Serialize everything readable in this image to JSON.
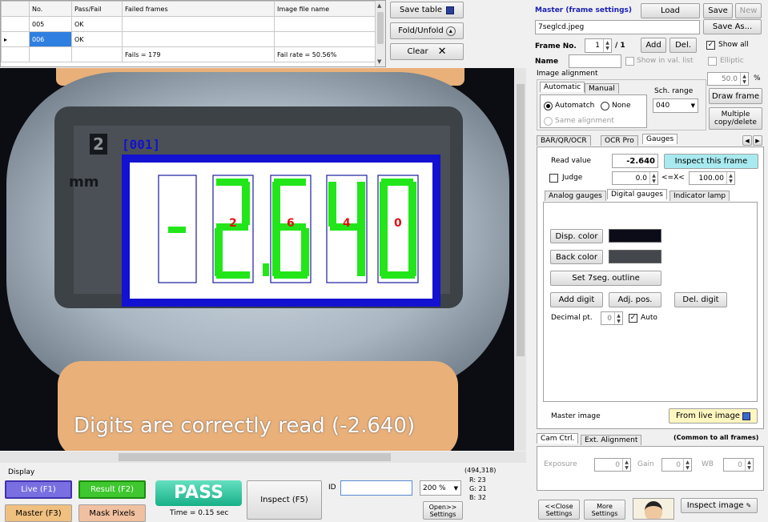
{
  "results_table": {
    "columns": [
      "No.",
      "Pass/Fail",
      "Failed frames",
      "Image file name"
    ],
    "rows": [
      {
        "no": "005",
        "pass_fail": "OK",
        "failed_frames": "",
        "image_file": ""
      },
      {
        "no": "006",
        "pass_fail": "OK",
        "failed_frames": "",
        "image_file": ""
      }
    ],
    "summary": {
      "fails": "Fails = 179",
      "fail_rate": "Fail rate = 50.56%"
    },
    "row_marker": "▸"
  },
  "table_buttons": {
    "save_table": "Save table",
    "fold_unfold": "Fold/Unfold",
    "fold_icon": "▴",
    "clear": "Clear",
    "clear_icon": "✕"
  },
  "viewer": {
    "unit_label": "mm",
    "mode_digit": "2",
    "frame_tag": "[001]",
    "detected_digits": [
      "2",
      "6",
      "4",
      "0"
    ],
    "caption": "Digits are correctly read (-2.640)",
    "colors": {
      "frame": "#1212d0",
      "segment": "#22e61a",
      "digit_label": "#e01010"
    }
  },
  "master": {
    "title": "Master (frame settings)",
    "load": "Load",
    "save": "Save",
    "new": "New",
    "save_as": "Save As...",
    "file_name": "7seglcd.jpeg",
    "frame_no_label": "Frame No.",
    "frame_no": "1",
    "frame_total": "/ 1",
    "add": "Add",
    "del": "Del.",
    "show_all": "Show all",
    "name_label": "Name",
    "name_value": "",
    "show_in_val_list": "Show in val. list",
    "elliptic": "Elliptic",
    "zoom_value": "50.0",
    "zoom_unit": "%",
    "draw_frame": "Draw frame",
    "multiple_copy": "Multiple copy/delete"
  },
  "alignment": {
    "title": "Image alignment",
    "tabs": [
      "Automatic",
      "Manual"
    ],
    "automatch": "Automatch",
    "none": "None",
    "same_alignment": "Same alignment",
    "sch_range_label": "Sch. range",
    "sch_range_value": "040"
  },
  "tool_tabs": [
    "BAR/QR/OCR",
    "OCR Pro",
    "Gauges"
  ],
  "gauges": {
    "read_value_label": "Read value",
    "read_value": "-2.640",
    "inspect_this_frame": "Inspect this frame",
    "judge_label": "Judge",
    "judge_low": "0.0",
    "judge_op": "<=X<",
    "judge_high": "100.00",
    "sub_tabs": [
      "Analog gauges",
      "Digital gauges",
      "Indicator lamp"
    ],
    "disp_color": "Disp. color",
    "back_color": "Back color",
    "disp_color_swatch": "#0c0c18",
    "back_color_swatch": "#44484c",
    "set_outline": "Set 7seg. outline",
    "add_digit": "Add digit",
    "adj_pos": "Adj. pos.",
    "del_digit": "Del. digit",
    "decimal_label": "Decimal pt.",
    "decimal_value": "0",
    "auto": "Auto",
    "master_image_label": "Master image",
    "from_live_image": "From live image"
  },
  "camera": {
    "tabs": [
      "Cam Ctrl.",
      "Ext. Alignment"
    ],
    "common_note": "(Common to all frames)",
    "exposure_label": "Exposure",
    "exposure": "0",
    "gain_label": "Gain",
    "gain": "0",
    "wb_label": "WB",
    "wb": "0"
  },
  "bottom": {
    "display_label": "Display",
    "live": "Live (F1)",
    "result": "Result (F2)",
    "master": "Master (F3)",
    "mask_pixels": "Mask Pixels",
    "pass": "PASS",
    "time": "Time = 0.15 sec",
    "inspect": "Inspect (F5)",
    "id_label": "ID",
    "id_value": "",
    "zoom": "200 %",
    "coords": "(494,318)",
    "r": "R: 23",
    "g": "G: 21",
    "b": "B: 32",
    "open_settings": "Open>> Settings",
    "close_settings": "<<Close Settings",
    "more_settings": "More Settings",
    "inspect_image": "Inspect image"
  }
}
